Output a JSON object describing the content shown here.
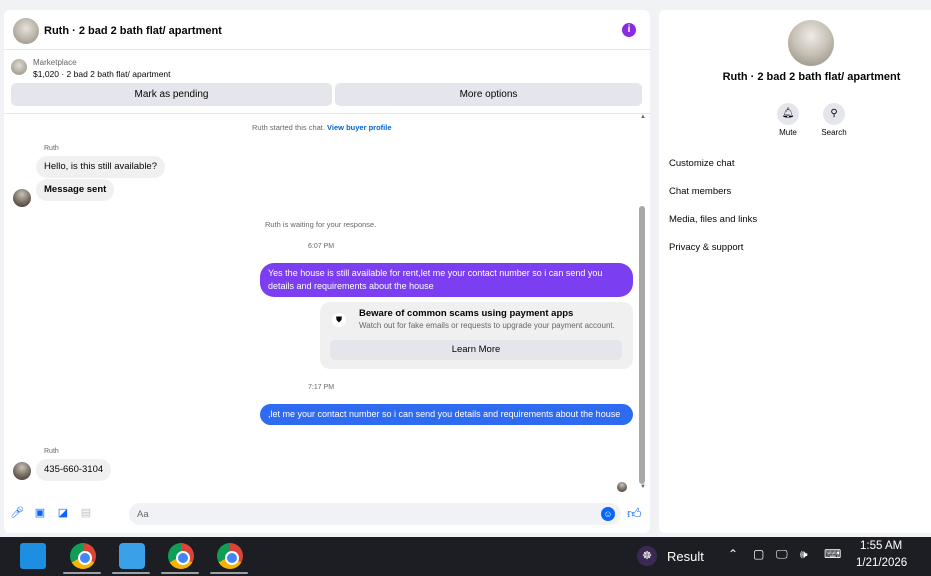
{
  "header": {
    "title": "Ruth · 2 bad 2 bath flat/ apartment"
  },
  "listing": {
    "category": "Marketplace",
    "price_title": "$1,020 · 2 bad 2 bath flat/ apartment",
    "mark_pending_label": "Mark as pending",
    "more_options_label": "More options"
  },
  "conversation": {
    "started_text": "Ruth started this chat.",
    "view_profile_link": "View buyer profile",
    "sender_name": "Ruth",
    "msg_available": "Hello, is this still available?",
    "msg_sent": "Message sent",
    "waiting_text": "Ruth is waiting for your response.",
    "time_1": "6:07 PM",
    "out_msg_1": "Yes the house is still available for rent,let me your contact number so i can send you details and requirements about the house",
    "scam_title": "Beware of common scams using payment apps",
    "scam_desc": "Watch out for fake emails or requests to upgrade your payment account.",
    "learn_more_label": "Learn More",
    "time_2": "7:17 PM",
    "out_msg_2": ",let me your contact number so i can send you details and requirements about the house",
    "sender_name_2": "Ruth",
    "phone_msg": "435-660-3104"
  },
  "composer": {
    "placeholder": "Aa"
  },
  "info_panel": {
    "title": "Ruth · 2 bad 2 bath flat/ apartment",
    "mute_label": "Mute",
    "search_label": "Search",
    "menu": [
      "Customize chat",
      "Chat members",
      "Media, files and links",
      "Privacy & support"
    ]
  },
  "taskbar": {
    "result_label": "Result",
    "time": "1:55 AM",
    "date": "1/21/2026"
  },
  "colors": {
    "outgoing_purple": "#7b3ff1",
    "outgoing_blue": "#2f6bf0",
    "accent": "#0866ff"
  }
}
